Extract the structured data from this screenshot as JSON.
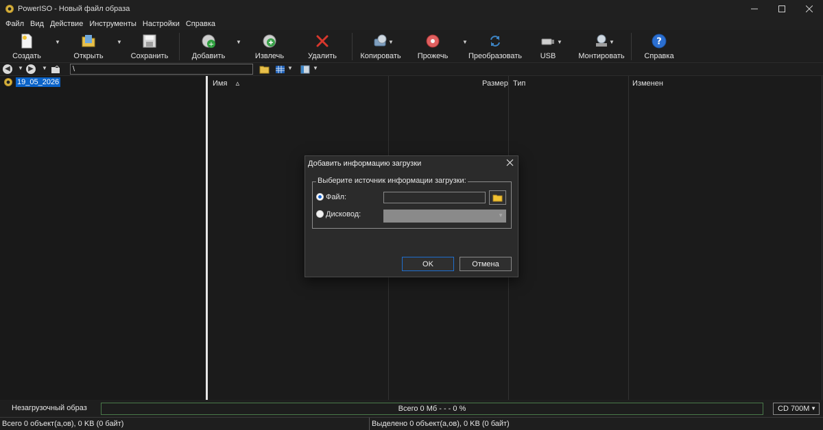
{
  "window": {
    "title": "PowerISO - Новый файл образа"
  },
  "menu": [
    "Файл",
    "Вид",
    "Действие",
    "Инструменты",
    "Настройки",
    "Справка"
  ],
  "toolbar": {
    "create": "Создать",
    "open": "Открыть",
    "save": "Сохранить",
    "add": "Добавить",
    "extract": "Извлечь",
    "delete": "Удалить",
    "copy": "Копировать",
    "burn": "Прожечь",
    "convert": "Преобразовать",
    "usb": "USB",
    "mount": "Монтировать",
    "help": "Справка"
  },
  "address": {
    "path": "\\"
  },
  "tree": {
    "root_label": "19_05_2026"
  },
  "columns": {
    "name": "Имя",
    "sort_indicator": "▵",
    "size": "Размер",
    "type": "Тип",
    "modified": "Изменен"
  },
  "status": {
    "image_type": "Незагрузочный образ",
    "total": "Всего  0 Мб   - - -  0 %",
    "media": "CD 700M",
    "objects_total": "Всего 0 объект(а,ов), 0 KB (0 байт)",
    "objects_selected": "Выделено 0 объект(а,ов), 0 KB (0 байт)"
  },
  "dialog": {
    "title": "Добавить информацию загрузки",
    "group_label": "Выберите источник информации загрузки:",
    "file_label": "Файл:",
    "drive_label": "Дисковод:",
    "file_value": "",
    "ok": "OK",
    "cancel": "Отмена"
  },
  "colors": {
    "accent": "#0a63c9",
    "radio_dot": "#1a66d0",
    "progress_border": "#4a7a4a"
  }
}
